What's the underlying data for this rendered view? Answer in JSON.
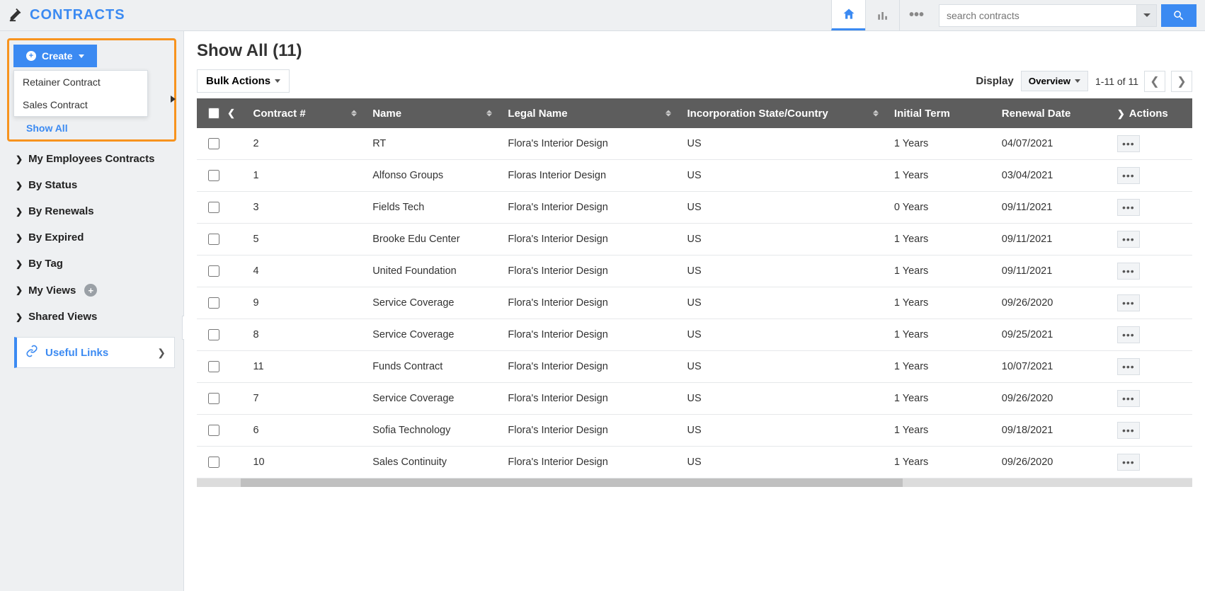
{
  "header": {
    "app_name": "CONTRACTS",
    "search_placeholder": "search contracts"
  },
  "sidebar": {
    "create_label": "Create",
    "create_menu": [
      {
        "label": "Retainer Contract"
      },
      {
        "label": "Sales Contract"
      }
    ],
    "show_all_label": "Show All",
    "nav": [
      {
        "label": "My Employees Contracts"
      },
      {
        "label": "By Status"
      },
      {
        "label": "By Renewals"
      },
      {
        "label": "By Expired"
      },
      {
        "label": "By Tag"
      },
      {
        "label": "My Views",
        "add": true
      },
      {
        "label": "Shared Views"
      }
    ],
    "useful_links_label": "Useful Links"
  },
  "main": {
    "title": "Show All  (11)",
    "bulk_actions_label": "Bulk Actions",
    "display_label": "Display",
    "overview_label": "Overview",
    "pager_text": "1-11 of 11",
    "columns": {
      "contract_no": "Contract #",
      "name": "Name",
      "legal_name": "Legal Name",
      "incorp": "Incorporation State/Country",
      "initial_term": "Initial Term",
      "renewal_date": "Renewal Date",
      "actions": "Actions"
    },
    "rows": [
      {
        "no": "2",
        "name": "RT",
        "legal": "Flora's Interior Design",
        "incorp": "US",
        "term": "1 Years",
        "renewal": "04/07/2021"
      },
      {
        "no": "1",
        "name": "Alfonso Groups",
        "legal": "Floras Interior Design",
        "incorp": "US",
        "term": "1 Years",
        "renewal": "03/04/2021"
      },
      {
        "no": "3",
        "name": "Fields Tech",
        "legal": "Flora's Interior Design",
        "incorp": "US",
        "term": "0 Years",
        "renewal": "09/11/2021"
      },
      {
        "no": "5",
        "name": "Brooke Edu Center",
        "legal": "Flora's Interior Design",
        "incorp": "US",
        "term": "1 Years",
        "renewal": "09/11/2021"
      },
      {
        "no": "4",
        "name": "United Foundation",
        "legal": "Flora's Interior Design",
        "incorp": "US",
        "term": "1 Years",
        "renewal": "09/11/2021"
      },
      {
        "no": "9",
        "name": "Service Coverage",
        "legal": "Flora's Interior Design",
        "incorp": "US",
        "term": "1 Years",
        "renewal": "09/26/2020"
      },
      {
        "no": "8",
        "name": "Service Coverage",
        "legal": "Flora's Interior Design",
        "incorp": "US",
        "term": "1 Years",
        "renewal": "09/25/2021"
      },
      {
        "no": "11",
        "name": "Funds Contract",
        "legal": "Flora's Interior Design",
        "incorp": "US",
        "term": "1 Years",
        "renewal": "10/07/2021"
      },
      {
        "no": "7",
        "name": "Service Coverage",
        "legal": "Flora's Interior Design",
        "incorp": "US",
        "term": "1 Years",
        "renewal": "09/26/2020"
      },
      {
        "no": "6",
        "name": "Sofia Technology",
        "legal": "Flora's Interior Design",
        "incorp": "US",
        "term": "1 Years",
        "renewal": "09/18/2021"
      },
      {
        "no": "10",
        "name": "Sales Continuity",
        "legal": "Flora's Interior Design",
        "incorp": "US",
        "term": "1 Years",
        "renewal": "09/26/2020"
      }
    ]
  }
}
